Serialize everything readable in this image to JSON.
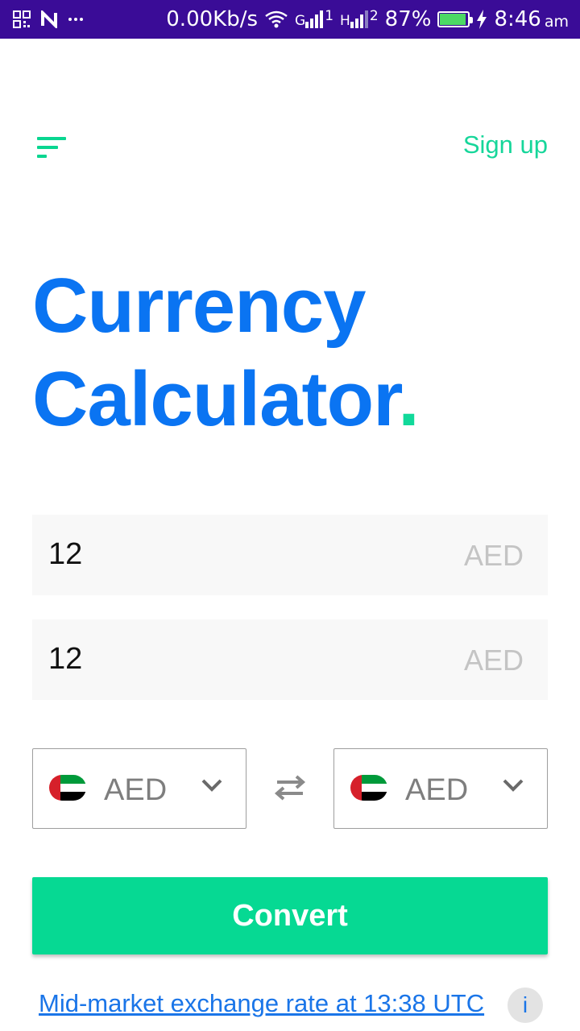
{
  "status_bar": {
    "left_icons": [
      "notification-grid-icon",
      "n-app-icon",
      "more-dots-icon"
    ],
    "network_speed": "0.00Kb/s",
    "wifi_icon": "wifi-icon",
    "sim1_type": "G",
    "sim1_slot": "1",
    "sim2_type": "H",
    "sim2_slot": "2",
    "battery_percent": "87%",
    "battery_level": 0.87,
    "charging_icon": "bolt-icon",
    "time": "8:46",
    "ampm": "am",
    "background_color": "#3a0c97"
  },
  "header": {
    "menu_icon": "menu-lines-icon",
    "signup_label": "Sign up"
  },
  "title": {
    "line1": "Currency",
    "line2": "Calculator",
    "dot": "."
  },
  "amount_inputs": [
    {
      "value": "12",
      "currency": "AED"
    },
    {
      "value": "12",
      "currency": "AED"
    }
  ],
  "currency_selectors": {
    "from": {
      "code": "AED",
      "flag": "uae-flag-icon",
      "dropdown_icon": "chevron-down-icon"
    },
    "swap_icon": "swap-arrows-icon",
    "to": {
      "code": "AED",
      "flag": "uae-flag-icon",
      "dropdown_icon": "chevron-down-icon"
    }
  },
  "convert_button": {
    "label": "Convert"
  },
  "footer": {
    "rate_link": "Mid-market exchange rate at 13:38 UTC",
    "info_label": "i"
  },
  "colors": {
    "brand_blue": "#0a74f2",
    "brand_green": "#06d993",
    "input_background": "#f8f8f8"
  }
}
